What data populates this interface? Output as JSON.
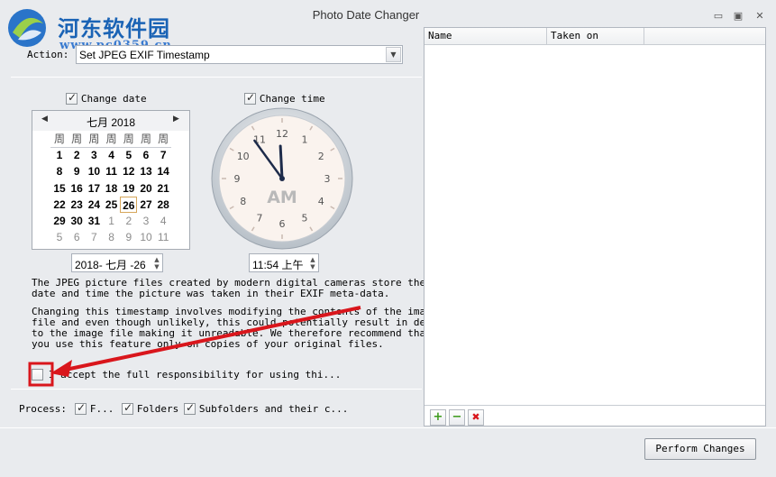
{
  "window": {
    "title": "Photo Date Changer",
    "controls": {
      "minimize": "▭",
      "maximize": "▣",
      "close": "✕"
    }
  },
  "watermark": {
    "text": "河东软件园",
    "url": "www.pc0359.cn"
  },
  "action": {
    "label": "Action:",
    "value": "Set JPEG EXIF Timestamp"
  },
  "date": {
    "checkbox_label": "Change date",
    "checked": true,
    "month_title": "七月 2018",
    "weekday_headers": [
      "周",
      "周",
      "周",
      "周",
      "周",
      "周",
      "周"
    ],
    "weeks": [
      [
        "1",
        "2",
        "3",
        "4",
        "5",
        "6",
        "7"
      ],
      [
        "8",
        "9",
        "10",
        "11",
        "12",
        "13",
        "14"
      ],
      [
        "15",
        "16",
        "17",
        "18",
        "19",
        "20",
        "21"
      ],
      [
        "22",
        "23",
        "24",
        "25",
        "26",
        "27",
        "28"
      ],
      [
        "29",
        "30",
        "31",
        "1",
        "2",
        "3",
        "4"
      ],
      [
        "5",
        "6",
        "7",
        "8",
        "9",
        "10",
        "11"
      ]
    ],
    "today": "26",
    "field_value": "2018- 七月 -26"
  },
  "time": {
    "checkbox_label": "Change time",
    "checked": true,
    "clock_label": "AM",
    "field_value": "11:54 上午",
    "hour": 11,
    "minute": 54
  },
  "description": {
    "para1": "The JPEG picture files created by modern digital cameras store the\ndate and time the picture was taken in their EXIF meta-data.",
    "para2": "Changing this timestamp involves modifying the contents of the image\nfile and even though unlikely, this could potentially result in demage\nto the image file making it unreadable. We therefore recommend that\nyou use this feature only on copies of your original files."
  },
  "accept": {
    "label": "I accept the full responsibility for using thi...",
    "checked": false
  },
  "process": {
    "label": "Process:",
    "options": [
      {
        "label": "F...",
        "checked": true
      },
      {
        "label": "Folders",
        "checked": true
      },
      {
        "label": "Subfolders and their c...",
        "checked": true
      }
    ]
  },
  "file_list": {
    "columns": [
      "Name",
      "Taken on"
    ],
    "rows": []
  },
  "toolbar": {
    "add": "+",
    "remove": "−",
    "delete": "✖"
  },
  "perform_button": "Perform Changes",
  "colors": {
    "accent_red": "#d9161c",
    "add_green": "#3c9a1a",
    "clock_face": "#faf3ee"
  }
}
